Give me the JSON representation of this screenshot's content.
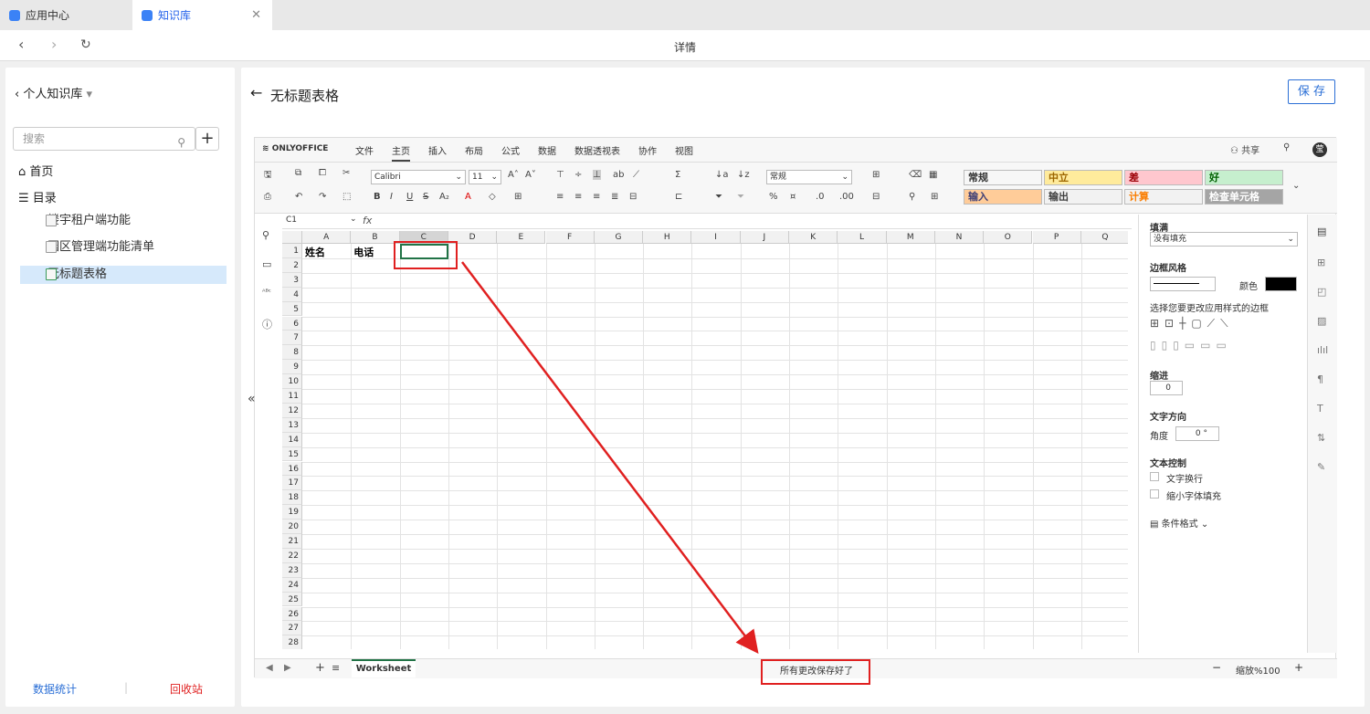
{
  "tabs": [
    {
      "label": "应用中心"
    },
    {
      "label": "知识库"
    }
  ],
  "nav": {
    "title": "详情"
  },
  "sidebar": {
    "header": "个人知识库",
    "search_placeholder": "搜索",
    "home": "首页",
    "toc": "目录",
    "docs": [
      {
        "label": "楼宇租户端功能",
        "selected": false
      },
      {
        "label": "园区管理端功能清单",
        "selected": false
      },
      {
        "label": "无标题表格",
        "selected": true
      }
    ],
    "footer_left": "数据统计",
    "footer_right": "回收站",
    "colors": {
      "selected_bg": "#d6e9fb",
      "footer_left": "#2b6fd6",
      "footer_right": "#e02020"
    }
  },
  "main": {
    "doc_title": "无标题表格",
    "save_label": "保 存"
  },
  "onlyoffice": {
    "logo": "ONLYOFFICE",
    "menu": [
      "文件",
      "主页",
      "插入",
      "布局",
      "公式",
      "数据",
      "数据透视表",
      "协作",
      "视图"
    ],
    "active_menu": "主页",
    "share": "共享",
    "font_name": "Calibri",
    "font_size": "11",
    "number_format": "常规",
    "cell_styles": [
      {
        "label": "常规",
        "bg": "#ffffff",
        "color": "#000000"
      },
      {
        "label": "中立",
        "bg": "#ffeb9c",
        "color": "#9c6500"
      },
      {
        "label": "差",
        "bg": "#ffc7ce",
        "color": "#9c0006"
      },
      {
        "label": "好",
        "bg": "#c6efce",
        "color": "#006100"
      },
      {
        "label": "输入",
        "bg": "#ffcc99",
        "color": "#3f3f76"
      },
      {
        "label": "输出",
        "bg": "#f2f2f2",
        "color": "#3f3f3f"
      },
      {
        "label": "计算",
        "bg": "#f2f2f2",
        "color": "#fa7d00"
      },
      {
        "label": "检查单元格",
        "bg": "#a5a5a5",
        "color": "#ffffff"
      }
    ],
    "cell_ref": "C1",
    "fx": "fx",
    "columns": [
      "A",
      "B",
      "C",
      "D",
      "E",
      "F",
      "G",
      "H",
      "I",
      "J",
      "K",
      "L",
      "M",
      "N",
      "O",
      "P",
      "Q"
    ],
    "rows": [
      "1",
      "2",
      "3",
      "4",
      "5",
      "6",
      "7",
      "8",
      "9",
      "10",
      "11",
      "12",
      "13",
      "14",
      "15",
      "16",
      "17",
      "18",
      "19",
      "20",
      "21",
      "22",
      "23",
      "24",
      "25",
      "26",
      "27",
      "28"
    ],
    "cells": {
      "A1": "姓名",
      "B1": "电话"
    },
    "right_panel": {
      "fill_title": "填满",
      "fill_value": "没有填充",
      "border_title": "边框风格",
      "color_label": "颜色",
      "border_hint": "选择您要更改应用样式的边框",
      "indent_title": "缩进",
      "indent_value": "0",
      "text_dir_title": "文字方向",
      "angle_label": "角度",
      "angle_value": "0 °",
      "text_control_title": "文本控制",
      "wrap_label": "文字换行",
      "shrink_label": "缩小字体填充",
      "cond_format": "条件格式"
    },
    "sheet_name": "Worksheet",
    "status_message": "所有更改保存好了",
    "zoom": "缩放%100"
  },
  "annotation_color": "#e02020"
}
